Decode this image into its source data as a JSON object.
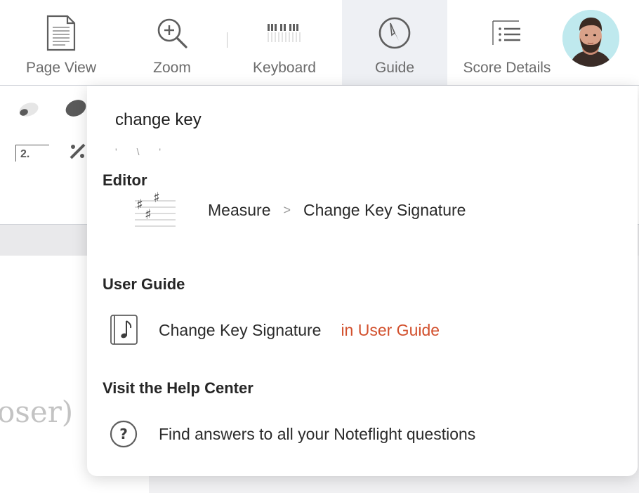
{
  "toolbar": {
    "items": [
      {
        "label": "Page View",
        "icon": "page-view-icon"
      },
      {
        "label": "Zoom",
        "icon": "zoom-icon"
      },
      {
        "label": "Keyboard",
        "icon": "keyboard-icon"
      },
      {
        "label": "Guide",
        "icon": "guide-compass-icon",
        "active": true
      },
      {
        "label": "Score Details",
        "icon": "score-details-icon"
      }
    ],
    "avatar": "user-avatar"
  },
  "background": {
    "palette_labels": [
      "2."
    ],
    "score_text": "oser)"
  },
  "guide_panel": {
    "search": {
      "value": "change key"
    },
    "sections": {
      "editor": {
        "title": "Editor",
        "result": {
          "path": "Measure",
          "separator": ">",
          "target": "Change Key Signature",
          "icon": "key-signature-icon"
        }
      },
      "user_guide": {
        "title": "User Guide",
        "result": {
          "label": "Change Key Signature",
          "link": "in User Guide",
          "icon": "music-note-book-icon"
        }
      },
      "help_center": {
        "title": "Visit the Help Center",
        "result": {
          "label": "Find answers to all your Noteflight questions",
          "icon": "question-circle-icon"
        }
      }
    }
  },
  "colors": {
    "accent_link": "#d2502d",
    "active_tab_bg": "#eef0f4",
    "icon_gray": "#5e5e5e"
  }
}
